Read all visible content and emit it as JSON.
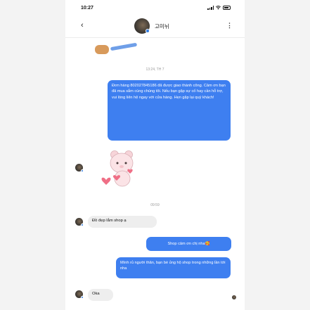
{
  "status": {
    "time": "10:27"
  },
  "header": {
    "back_icon": "‹",
    "contact_name": "고미뉘",
    "more_icon": "⋮"
  },
  "timestamps": [
    "13:24, TH 7",
    "09:59"
  ],
  "messages": {
    "out1": "Đơn hàng 802027845186 đã được giao thành công. Cảm ơn bạn đã mua sắm cùng chúng tôi. Nếu bạn gặp sự cố hay cần hỗ trợ, vui lòng liên hệ ngay với cửa hàng. Hẹn gặp lại quý khách!",
    "in1": "Đồ đẹp lắm shop ạ",
    "out2": "Shop cảm ơn chị nha🥰",
    "out3": "Mình rủ người thân, bạn bè ủng hộ shop trong những lần tới nha",
    "in2": "Oka"
  },
  "colors": {
    "outgoing_bubble": "#3e7ff0",
    "incoming_bubble": "#eeeeee",
    "online_dot": "#2f7be0"
  },
  "icons": {
    "sticker": "pink-bear-sticker",
    "read_receipt": "read-receipt-avatar"
  }
}
